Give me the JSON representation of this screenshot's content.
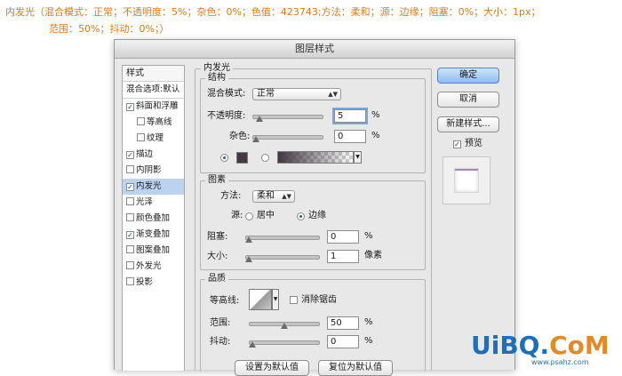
{
  "caption": {
    "line1": "内发光（混合模式：正常；不透明度：5%；杂色：0%；色值：423743;方法：柔和；源：边缘；阻塞：0%；大小：1px；",
    "line2": "范围：50%；抖动：0%；）"
  },
  "dialog": {
    "title": "图层样式"
  },
  "stylelist": {
    "header": "样式",
    "blend_options": "混合选项:默认",
    "items": [
      {
        "label": "斜面和浮雕",
        "checked": true
      },
      {
        "label": "等高线",
        "checked": false
      },
      {
        "label": "纹理",
        "checked": false
      },
      {
        "label": "描边",
        "checked": true
      },
      {
        "label": "内阴影",
        "checked": false
      },
      {
        "label": "内发光",
        "checked": true,
        "selected": true
      },
      {
        "label": "光泽",
        "checked": false
      },
      {
        "label": "颜色叠加",
        "checked": false
      },
      {
        "label": "渐变叠加",
        "checked": true
      },
      {
        "label": "图案叠加",
        "checked": false
      },
      {
        "label": "外发光",
        "checked": false
      },
      {
        "label": "投影",
        "checked": false
      }
    ],
    "check_mark": "✓"
  },
  "panel": {
    "title": "内发光",
    "structure": {
      "title": "结构",
      "blend_mode_label": "混合模式:",
      "blend_mode_value": "正常",
      "opacity_label": "不透明度:",
      "opacity_value": "5",
      "noise_label": "杂色:",
      "noise_value": "0",
      "percent": "%",
      "opacity_level": 5,
      "noise_level": 0,
      "color": "#423743"
    },
    "elements": {
      "title": "图素",
      "technique_label": "方法:",
      "technique_value": "柔和",
      "source_label": "源:",
      "source_center": "居中",
      "source_edge": "边缘",
      "choke_label": "阻塞:",
      "choke_value": "0",
      "size_label": "大小:",
      "size_value": "1",
      "percent": "%",
      "pixels": "像素",
      "choke_level": 0,
      "size_level": 1
    },
    "quality": {
      "title": "品质",
      "contour_label": "等高线:",
      "antialias_label": "消除锯齿",
      "range_label": "范围:",
      "range_value": "50",
      "jitter_label": "抖动:",
      "jitter_value": "0",
      "percent": "%",
      "range_level": 50,
      "jitter_level": 0
    },
    "bottom_buttons": {
      "set_default": "设置为默认值",
      "reset_default": "复位为默认值"
    }
  },
  "buttons": {
    "ok": "确定",
    "cancel": "取消",
    "new_style": "新建样式...",
    "preview": "预览"
  },
  "icons": {
    "dropdown": "chevron-updown-icon",
    "check": "checkmark-icon"
  },
  "watermark": {
    "main_a": "UiBQ.",
    "main_b": "CoM",
    "sub": "www.psahz.com"
  }
}
